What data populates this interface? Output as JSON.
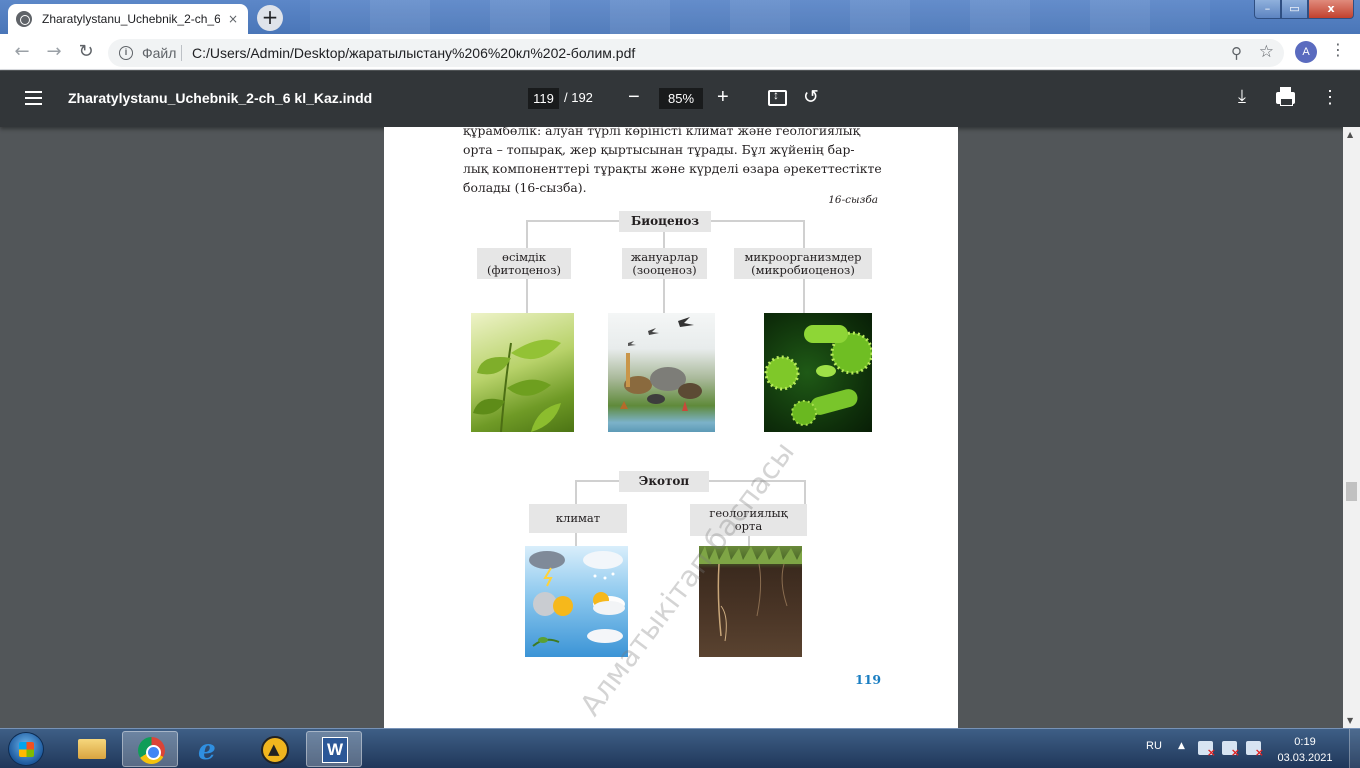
{
  "browser": {
    "tab_title": "Zharatylystanu_Uchebnik_2-ch_6",
    "tab_close": "×",
    "new_tab": "+",
    "window_controls": {
      "minimize": "–",
      "maximize": "▭",
      "close": "x"
    },
    "nav": {
      "back": "←",
      "forward": "→",
      "reload": "↻"
    },
    "address": {
      "info": "i",
      "scheme": "Файл",
      "url": "C:/Users/Admin/Desktop/жаратылыстану%206%20кл%202-болим.pdf"
    },
    "zoom_icon": "⚲",
    "star_icon": "☆",
    "profile_letter": "A",
    "menu": "⋮"
  },
  "pdf_toolbar": {
    "title": "Zharatylystanu_Uchebnik_2-ch_6 kl_Kaz.indd",
    "current_page": "119",
    "total_pages": "/ 192",
    "zoom_out": "−",
    "zoom": "85%",
    "zoom_in": "+",
    "rotate": "↺",
    "download": "⤓",
    "more": "⋮"
  },
  "scrollbar": {
    "up": "▲",
    "down": "▼"
  },
  "page": {
    "text_lines": [
      "құрамбөлік: алуан түрлі көріністі климат және геологиялық",
      "орта – топырақ, жер қыртысынан тұрады. Бұл жүйенің бар-",
      "лық компоненттері тұрақты және күрделі өзара әрекеттестікте",
      "болады (16-сызба)."
    ],
    "caption": "16-сызба",
    "diagram1": {
      "root": "Биоценоз",
      "children": [
        {
          "line1": "өсімдік",
          "line2": "(фитоценоз)"
        },
        {
          "line1": "жануарлар",
          "line2": "(зооценоз)"
        },
        {
          "line1": "микроорганизмдер",
          "line2": "(микробиоценоз)"
        }
      ]
    },
    "diagram2": {
      "root": "Экотоп",
      "children": [
        {
          "line1": "климат",
          "line2": ""
        },
        {
          "line1": "геологиялық",
          "line2": "орта"
        }
      ]
    },
    "page_number": "119",
    "watermark": "Алматыкітап баспасы"
  },
  "taskbar": {
    "language": "RU",
    "tray_arrow": "▲",
    "time": "0:19",
    "date": "03.03.2021",
    "word_letter": "W"
  }
}
